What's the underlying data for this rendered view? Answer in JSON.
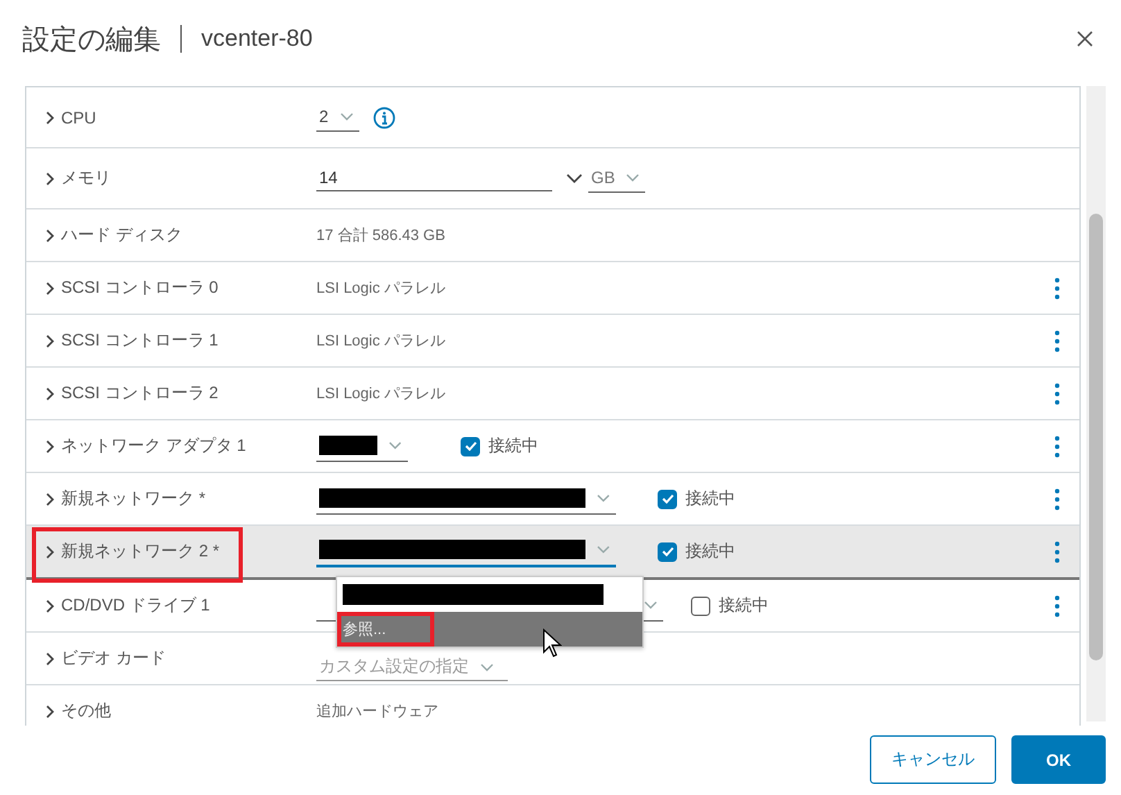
{
  "dialog": {
    "title": "設定の編集",
    "subtitle": "vcenter-80"
  },
  "rows": [
    {
      "kind": "select",
      "label": "CPU",
      "value": "2",
      "info": true,
      "selected": false
    },
    {
      "kind": "memory",
      "label": "メモリ",
      "value": "14",
      "unit": "GB",
      "selected": false
    },
    {
      "kind": "text",
      "label": "ハード ディスク",
      "value": "17 合計 586.43 GB",
      "selected": false
    },
    {
      "kind": "text",
      "label": "SCSI コントローラ 0",
      "value": "LSI Logic パラレル",
      "menu": true,
      "selected": false
    },
    {
      "kind": "text",
      "label": "SCSI コントローラ 1",
      "value": "LSI Logic パラレル",
      "menu": true,
      "selected": false
    },
    {
      "kind": "text",
      "label": "SCSI コントローラ 2",
      "value": "LSI Logic パラレル",
      "menu": true,
      "selected": false
    },
    {
      "kind": "network",
      "label": "ネットワーク アダプタ 1",
      "redacted": true,
      "wide": false,
      "checkbox": "接続中",
      "connected": true,
      "menu": true,
      "selected": false
    },
    {
      "kind": "network",
      "label": "新規ネットワーク *",
      "redacted": true,
      "wide": true,
      "checkbox": "接続中",
      "connected": true,
      "menu": true,
      "selected": false
    },
    {
      "kind": "network",
      "label": "新規ネットワーク 2 *",
      "redacted": true,
      "wide": true,
      "checkbox": "接続中",
      "connected": true,
      "menu": true,
      "selected": true,
      "annotated": true,
      "dropdown": [
        {
          "kind": "redacted",
          "selected": false
        },
        {
          "kind": "text",
          "label": "参照...",
          "selected": true,
          "annotated": true
        }
      ]
    },
    {
      "kind": "network",
      "label": "CD/DVD ドライブ 1",
      "redacted": false,
      "wide": true,
      "checkbox": "接続中",
      "connected": false,
      "menu": true,
      "selected": false
    },
    {
      "kind": "select_empty",
      "label": "ビデオ カード",
      "placeholder": "カスタム設定の指定",
      "selected": false
    },
    {
      "kind": "text",
      "label": "その他",
      "value": "追加ハードウェア",
      "selected": false
    }
  ],
  "buttons": [
    {
      "label": "キャンセル",
      "kind": "secondary"
    },
    {
      "label": "OK",
      "kind": "primary"
    }
  ]
}
